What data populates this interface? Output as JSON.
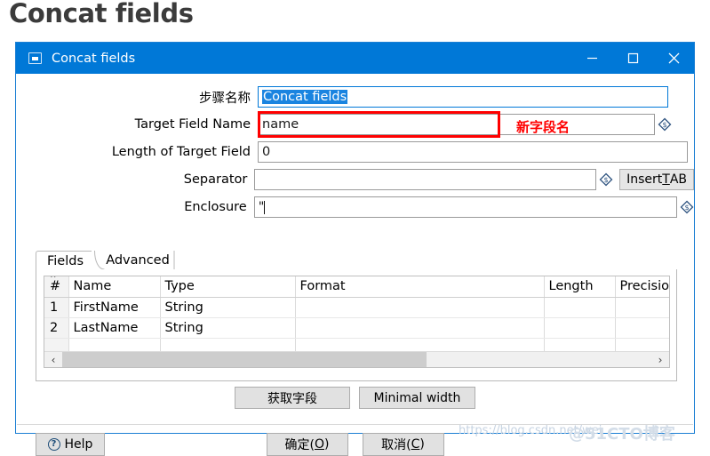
{
  "page": {
    "heading": "Concat fields"
  },
  "dialog": {
    "titlebar": {
      "title": "Concat fields",
      "icon": "window-restore-icon",
      "minimize_label": "–",
      "maximize_label": "□",
      "close_label": "✕"
    },
    "form": {
      "fields": [
        {
          "label": "步骤名称",
          "value": "Concat fields",
          "selected": true,
          "has_var_icon": false,
          "focused": true
        },
        {
          "label": "Target Field Name",
          "value": "name",
          "selected": false,
          "has_var_icon": true,
          "focused": false
        },
        {
          "label": "Length of Target Field",
          "value": "0",
          "selected": false,
          "has_var_icon": false,
          "focused": false
        },
        {
          "label": "Separator",
          "value": "",
          "selected": false,
          "has_var_icon": true,
          "focused": false
        },
        {
          "label": "Enclosure",
          "value": "\"",
          "selected": false,
          "has_var_icon": true,
          "focused": false
        }
      ],
      "insert_tab_button": {
        "pre": "Insert ",
        "mnemonic": "T",
        "post": "AB"
      }
    },
    "annotation": {
      "text": "新字段名",
      "color": "#ff0000"
    },
    "tabs": [
      {
        "label": "Fields",
        "selected": true
      },
      {
        "label": "Advanced",
        "selected": false
      }
    ],
    "table": {
      "columns": [
        "#",
        "Name",
        "Type",
        "Format",
        "Length",
        "Precision"
      ],
      "rows": [
        {
          "index": "1",
          "name": "FirstName",
          "type": "String",
          "format": "",
          "length": "",
          "precision": ""
        },
        {
          "index": "2",
          "name": "LastName",
          "type": "String",
          "format": "",
          "length": "",
          "precision": ""
        },
        {
          "index": "",
          "name": "",
          "type": "",
          "format": "",
          "length": "",
          "precision": ""
        }
      ],
      "scroll_left_label": "‹",
      "scroll_right_label": "›"
    },
    "buttons": {
      "get_fields": "获取字段",
      "minimal_width": "Minimal width",
      "ok_pre": "确定(",
      "ok_mnemonic": "O",
      "ok_post": ")",
      "cancel_pre": "取消(",
      "cancel_mnemonic": "C",
      "cancel_post": ")",
      "help": "Help",
      "help_icon": "question-circle-icon"
    }
  },
  "watermarks": {
    "url": "https://blog.csdn.net/wei",
    "site": "@51CTO博客"
  },
  "colors": {
    "titlebar": "#0078d7",
    "accent_border": "#1b7fd4",
    "annotation_red": "#ff0000",
    "selection_blue": "#1a84e0"
  }
}
